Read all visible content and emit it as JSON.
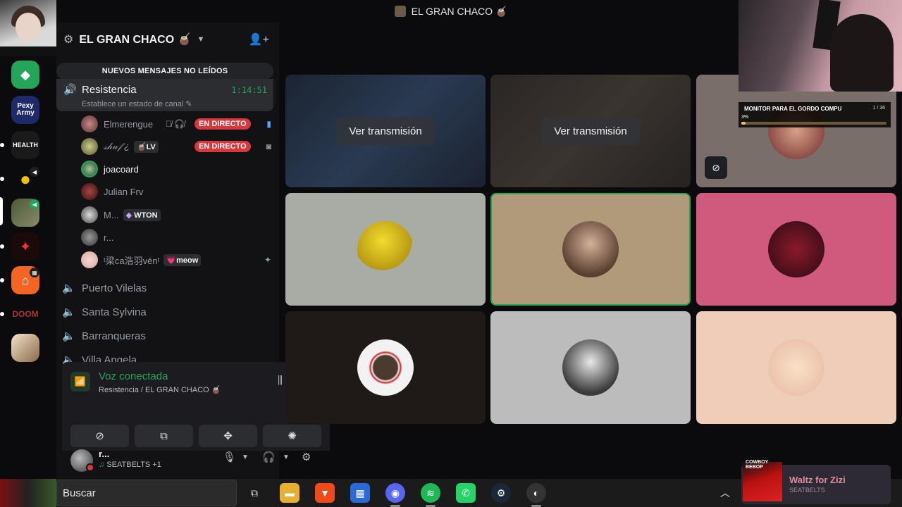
{
  "window": {
    "title": "EL GRAN CHACO 🧉"
  },
  "server_rail": {
    "items": [
      {
        "label": ""
      },
      {
        "label": "Pexy Army"
      },
      {
        "label": "HEALTH"
      },
      {
        "label": ""
      },
      {
        "label": ""
      },
      {
        "label": ""
      },
      {
        "label": ""
      },
      {
        "label": "DOOM"
      },
      {
        "label": ""
      }
    ]
  },
  "sidebar": {
    "server_name": "EL GRAN CHACO 🧉",
    "new_messages_banner": "NUEVOS MENSAJES NO LEÍDOS",
    "active_channel": {
      "name": "Resistencia",
      "timer": "1:14:51",
      "status_placeholder": "Establece un estado de canal"
    },
    "members": [
      {
        "name": "Elmerengue",
        "live": "EN DIRECTO"
      },
      {
        "name": "𝓈𝒽𝓊𝒻 ¿",
        "tag": "🧉LV",
        "live": "EN DIRECTO"
      },
      {
        "name": "joacoard"
      },
      {
        "name": "Julian Frv"
      },
      {
        "name": "M...",
        "tag": "WTON"
      },
      {
        "name": "r..."
      },
      {
        "name": "ᵗ梁ca浩羽vēnᵗ",
        "tag": "💗meow"
      }
    ],
    "voice_channels": [
      "Puerto Vilelas",
      "Santa Sylvina",
      "Barranqueras",
      "Villa Angela"
    ]
  },
  "voice_panel": {
    "title": "Voz conectada",
    "subtitle": "Resistencia / EL GRAN CHACO 🧉"
  },
  "user_panel": {
    "name": "r...",
    "activity": "SEATBELTS +1"
  },
  "stage": {
    "watch_label": "Ver transmisión",
    "monitor_overlay": {
      "title": "MONITOR PARA EL GORDO COMPU",
      "count": "1 / 36",
      "percent_label": "3%",
      "progress": 0.03
    }
  },
  "taskbar": {
    "search_placeholder": "Buscar"
  },
  "media": {
    "album_text": "COWBOY BEBOP",
    "song": "Waltz for Zizi",
    "artist": "SEATBELTS"
  },
  "colors": {
    "green": "#23a55a",
    "live_red": "#da373c",
    "accent_pink": "#e08aa0"
  }
}
